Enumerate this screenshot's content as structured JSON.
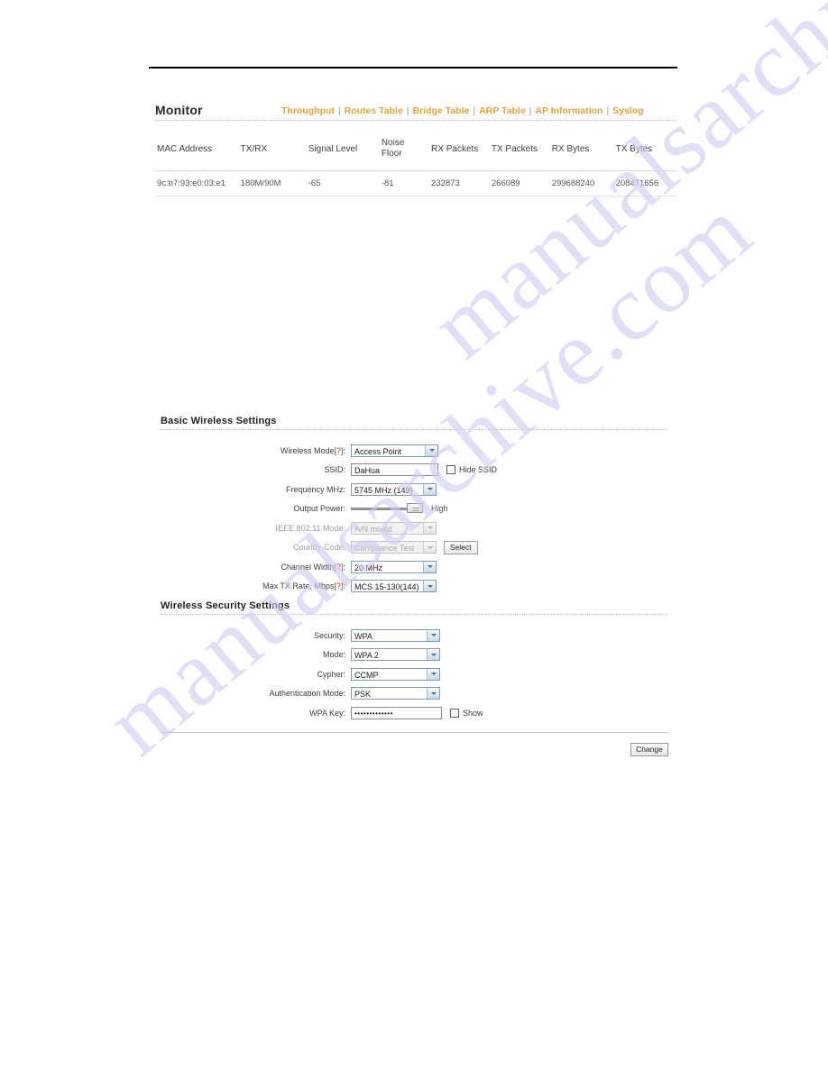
{
  "monitor": {
    "title": "Monitor",
    "nav": [
      {
        "label": "Throughput"
      },
      {
        "label": "Routes Table"
      },
      {
        "label": "Bridge Table"
      },
      {
        "label": "ARP Table"
      },
      {
        "label": "AP Information"
      },
      {
        "label": "Syslog"
      }
    ],
    "separator": "|",
    "table": {
      "columns": [
        "MAC Address",
        "TX/RX",
        "Signal Level",
        "Noise Floor",
        "RX Packets",
        "TX Packets",
        "RX Bytes",
        "TX Bytes"
      ],
      "rows": [
        {
          "mac": "9c:b7:93:e0:03:e1",
          "txrx": "180M/90M",
          "signal_level": "-65",
          "noise_floor": "-81",
          "rx_packets": "232873",
          "tx_packets": "266089",
          "rx_bytes": "299688240",
          "tx_bytes": "208471656"
        }
      ]
    }
  },
  "basic_wireless": {
    "title": "Basic Wireless Settings",
    "wireless_mode": {
      "label": "Wireless Mode",
      "help": "[?]",
      "value": "Access Point"
    },
    "ssid": {
      "label": "SSID:",
      "value": "DaHua"
    },
    "hide_ssid": {
      "label": "Hide SSID",
      "checked": false
    },
    "frequency": {
      "label": "Frequency MHz:",
      "value": "5745 MHz (149)"
    },
    "output_power": {
      "label": "Output Power:",
      "value": "High"
    },
    "ieee_mode": {
      "label": "IEEE 802.11 Mode:",
      "value": "A/N mixed",
      "disabled": true
    },
    "country_code": {
      "label": "Country Code:",
      "value": "Compliance Test",
      "disabled": true,
      "button": "Select"
    },
    "channel_width": {
      "label": "Channel Width",
      "help": "[?]",
      "value": "20 MHz"
    },
    "max_tx_rate": {
      "label": "Max TX Rate, Mbps",
      "help": "[?]",
      "value": "MCS 15-130(144)"
    }
  },
  "wireless_security": {
    "title": "Wireless Security Settings",
    "security": {
      "label": "Security:",
      "value": "WPA"
    },
    "mode": {
      "label": "Mode:",
      "value": "WPA 2"
    },
    "cypher": {
      "label": "Cypher:",
      "value": "CCMP"
    },
    "auth_mode": {
      "label": "Authentication Mode:",
      "value": "PSK"
    },
    "wpa_key": {
      "label": "WPA Key:",
      "value": "•••••••••••••"
    },
    "show_key": {
      "label": "Show",
      "checked": false
    }
  },
  "footer": {
    "change_button": "Change"
  },
  "watermark": {
    "line1": "manualsarchive.com",
    "line2": "manualsarchive.com"
  },
  "colors": {
    "nav_link": "#e8a33d",
    "help_marker": "#cc3333",
    "select_border": "#7f9db9"
  }
}
